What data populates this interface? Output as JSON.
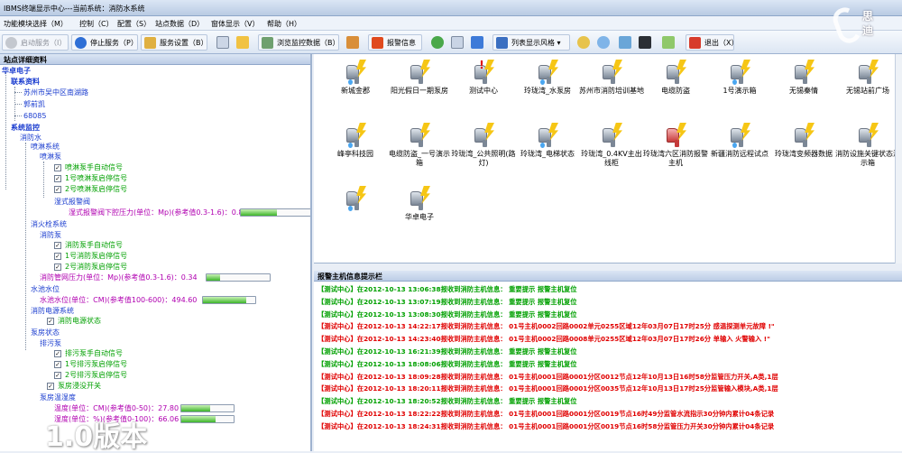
{
  "window": {
    "title": "IBMS终端显示中心---当前系统：消防水系统"
  },
  "logo": {
    "text_top": "思",
    "text_bottom": "迪"
  },
  "menu": [
    "功能模块选择（M）",
    "控制（C）",
    "配置（S）",
    "站点数据（D）",
    "窗体显示（V）",
    "帮助（H）"
  ],
  "toolbar": {
    "start": "启动服务（I）",
    "stop": "停止服务（P）",
    "settings": "服务设置（B）",
    "browse": "浏览监控数据（B）",
    "alarm": "报警信息",
    "list_style": "列表显示风格",
    "exit": "退出（X）"
  },
  "left": {
    "header": "站点详细资料",
    "root": "华卓电子",
    "contact_title": "联系资料",
    "contact": [
      "苏州市吴中区南湖路",
      "郭前凯",
      "68085"
    ],
    "monitor_title": "系统监控",
    "water": "消防水",
    "spray_sys": "喷淋系统",
    "spray_pump": "喷淋泵",
    "spray_items": [
      "喷淋泵手自动信号",
      "1号喷淋泵启停信号",
      "2号喷淋泵启停信号"
    ],
    "alarm_valve": "湿式报警阀",
    "valve_pressure": "湿式报警阀下腔压力(单位：Mp)(参考值0.3-1.6)：0.83",
    "valve_level": 0.83,
    "hydrant_sys": "消火栓系统",
    "hydrant_pump": "消防泵",
    "hydrant_items": [
      "消防泵手自动信号",
      "1号消防泵启停信号",
      "2号消防泵启停信号"
    ],
    "pipe_pressure": "消防管网压力(单位：Mp)(参考值0.3-1.6)：0.34",
    "pipe_level": 0.34,
    "pool": "水池水位",
    "pool_level_text": "水池水位(单位：CM)(参考值100-600)：494.60",
    "pool_level": 494.6,
    "power_sys": "消防电源系统",
    "power_item": "消防电源状态",
    "pump_room": "泵房状态",
    "drain_pump": "排污泵",
    "drain_items": [
      "排污泵手自动信号",
      "1号排污泵启停信号",
      "2号排污泵启停信号"
    ],
    "flood": "泵房浸没开关",
    "temp_hum": "泵房温湿度",
    "temp_text": "温度(单位：CM)(参考值0-50)：27.80",
    "temp_level": 27.8,
    "hum_text": "湿度(单位：%)(参考值0-100)：66.06",
    "hum_level": 66.06
  },
  "watermark": "1.0版本",
  "nodes": [
    {
      "label": "新城金郡",
      "alert": false
    },
    {
      "label": "阳光假日一期泵房",
      "alert": false
    },
    {
      "label": "测试中心",
      "alert": "excl"
    },
    {
      "label": "玲珑湾_水泵房",
      "alert": false
    },
    {
      "label": "苏州市消防培训基地",
      "alert": false
    },
    {
      "label": "电缆防盗",
      "alert": false
    },
    {
      "label": "1号演示箱",
      "alert": false
    },
    {
      "label": "无锡秦情",
      "alert": false
    },
    {
      "label": "无锡站前广场",
      "alert": false
    },
    {
      "label": "峰亭科技园",
      "alert": false
    },
    {
      "label": "电缆防盗_一号演示箱",
      "alert": false
    },
    {
      "label": "玲珑湾_公共照明(路灯)",
      "alert": false
    },
    {
      "label": "玲珑湾_电梯状态",
      "alert": false
    },
    {
      "label": "玲珑湾_0.4KV主出线柜",
      "alert": false
    },
    {
      "label": "玲珑湾六区消防报警主机",
      "alert": "red"
    },
    {
      "label": "新疆消防远程试点",
      "alert": false
    },
    {
      "label": "玲珑湾变频器数据",
      "alert": false
    },
    {
      "label": "消防设施关键状态演示箱",
      "alert": false
    },
    {
      "label": "",
      "alert": false
    },
    {
      "label": "华卓电子",
      "alert": false
    }
  ],
  "alarm_header": "报警主机信息提示栏",
  "alarms": [
    {
      "text": "【测试中心】在2012-10-13 13:06:38报收到消防主机信息：  重要提示    报警主机复位",
      "type": "ok"
    },
    {
      "text": "【测试中心】在2012-10-13 13:07:19报收到消防主机信息：  重要提示    报警主机复位",
      "type": "ok"
    },
    {
      "text": "【测试中心】在2012-10-13 13:08:30报收到消防主机信息：  重要提示    报警主机复位",
      "type": "ok"
    },
    {
      "text": "【测试中心】在2012-10-13 14:22:17报收到消防主机信息：  01号主机0002回路0002单元0255区域12年03月07日17时25分     感温探测单元故障   !\"",
      "type": "bad"
    },
    {
      "text": "【测试中心】在2012-10-13 14:23:40报收到消防主机信息：  01号主机0002回路0008单元0255区域12年03月07日17时26分     单输入    火警输入   !\"",
      "type": "bad"
    },
    {
      "text": "【测试中心】在2012-10-13 16:21:39报收到消防主机信息：  重要提示    报警主机复位",
      "type": "ok"
    },
    {
      "text": "【测试中心】在2012-10-13 18:08:06报收到消防主机信息：  重要提示    报警主机复位",
      "type": "ok"
    },
    {
      "text": "【测试中心】在2012-10-13 18:09:28报收到消防主机信息：  01号主机0001回路0001分区0012节点12年10月13日16时58分监管压力开关,A类,1层",
      "type": "bad"
    },
    {
      "text": "【测试中心】在2012-10-13 18:20:11报收到消防主机信息：  01号主机0001回路0001分区0035节点12年10月13日17时25分监管输入模块,A类,1层",
      "type": "bad"
    },
    {
      "text": "【测试中心】在2012-10-13 18:20:52报收到消防主机信息：  重要提示    报警主机复位",
      "type": "ok"
    },
    {
      "text": "【测试中心】在2012-10-13 18:22:22报收到消防主机信息：  01号主机0001回路0001分区0019节点16时49分监管水流指示30分钟内累计04条记录",
      "type": "bad"
    },
    {
      "text": "【测试中心】在2012-10-13 18:24:31报收到消防主机信息：  01号主机0001回路0001分区0019节点16时58分监管压力开关30分钟内累计04条记录",
      "type": "bad"
    }
  ],
  "colors": {
    "ok": "#00a000",
    "bad": "#e00000",
    "tree_blue": "#1a3ccf",
    "tree_purple": "#b000b0",
    "progress": "#3db52a"
  }
}
